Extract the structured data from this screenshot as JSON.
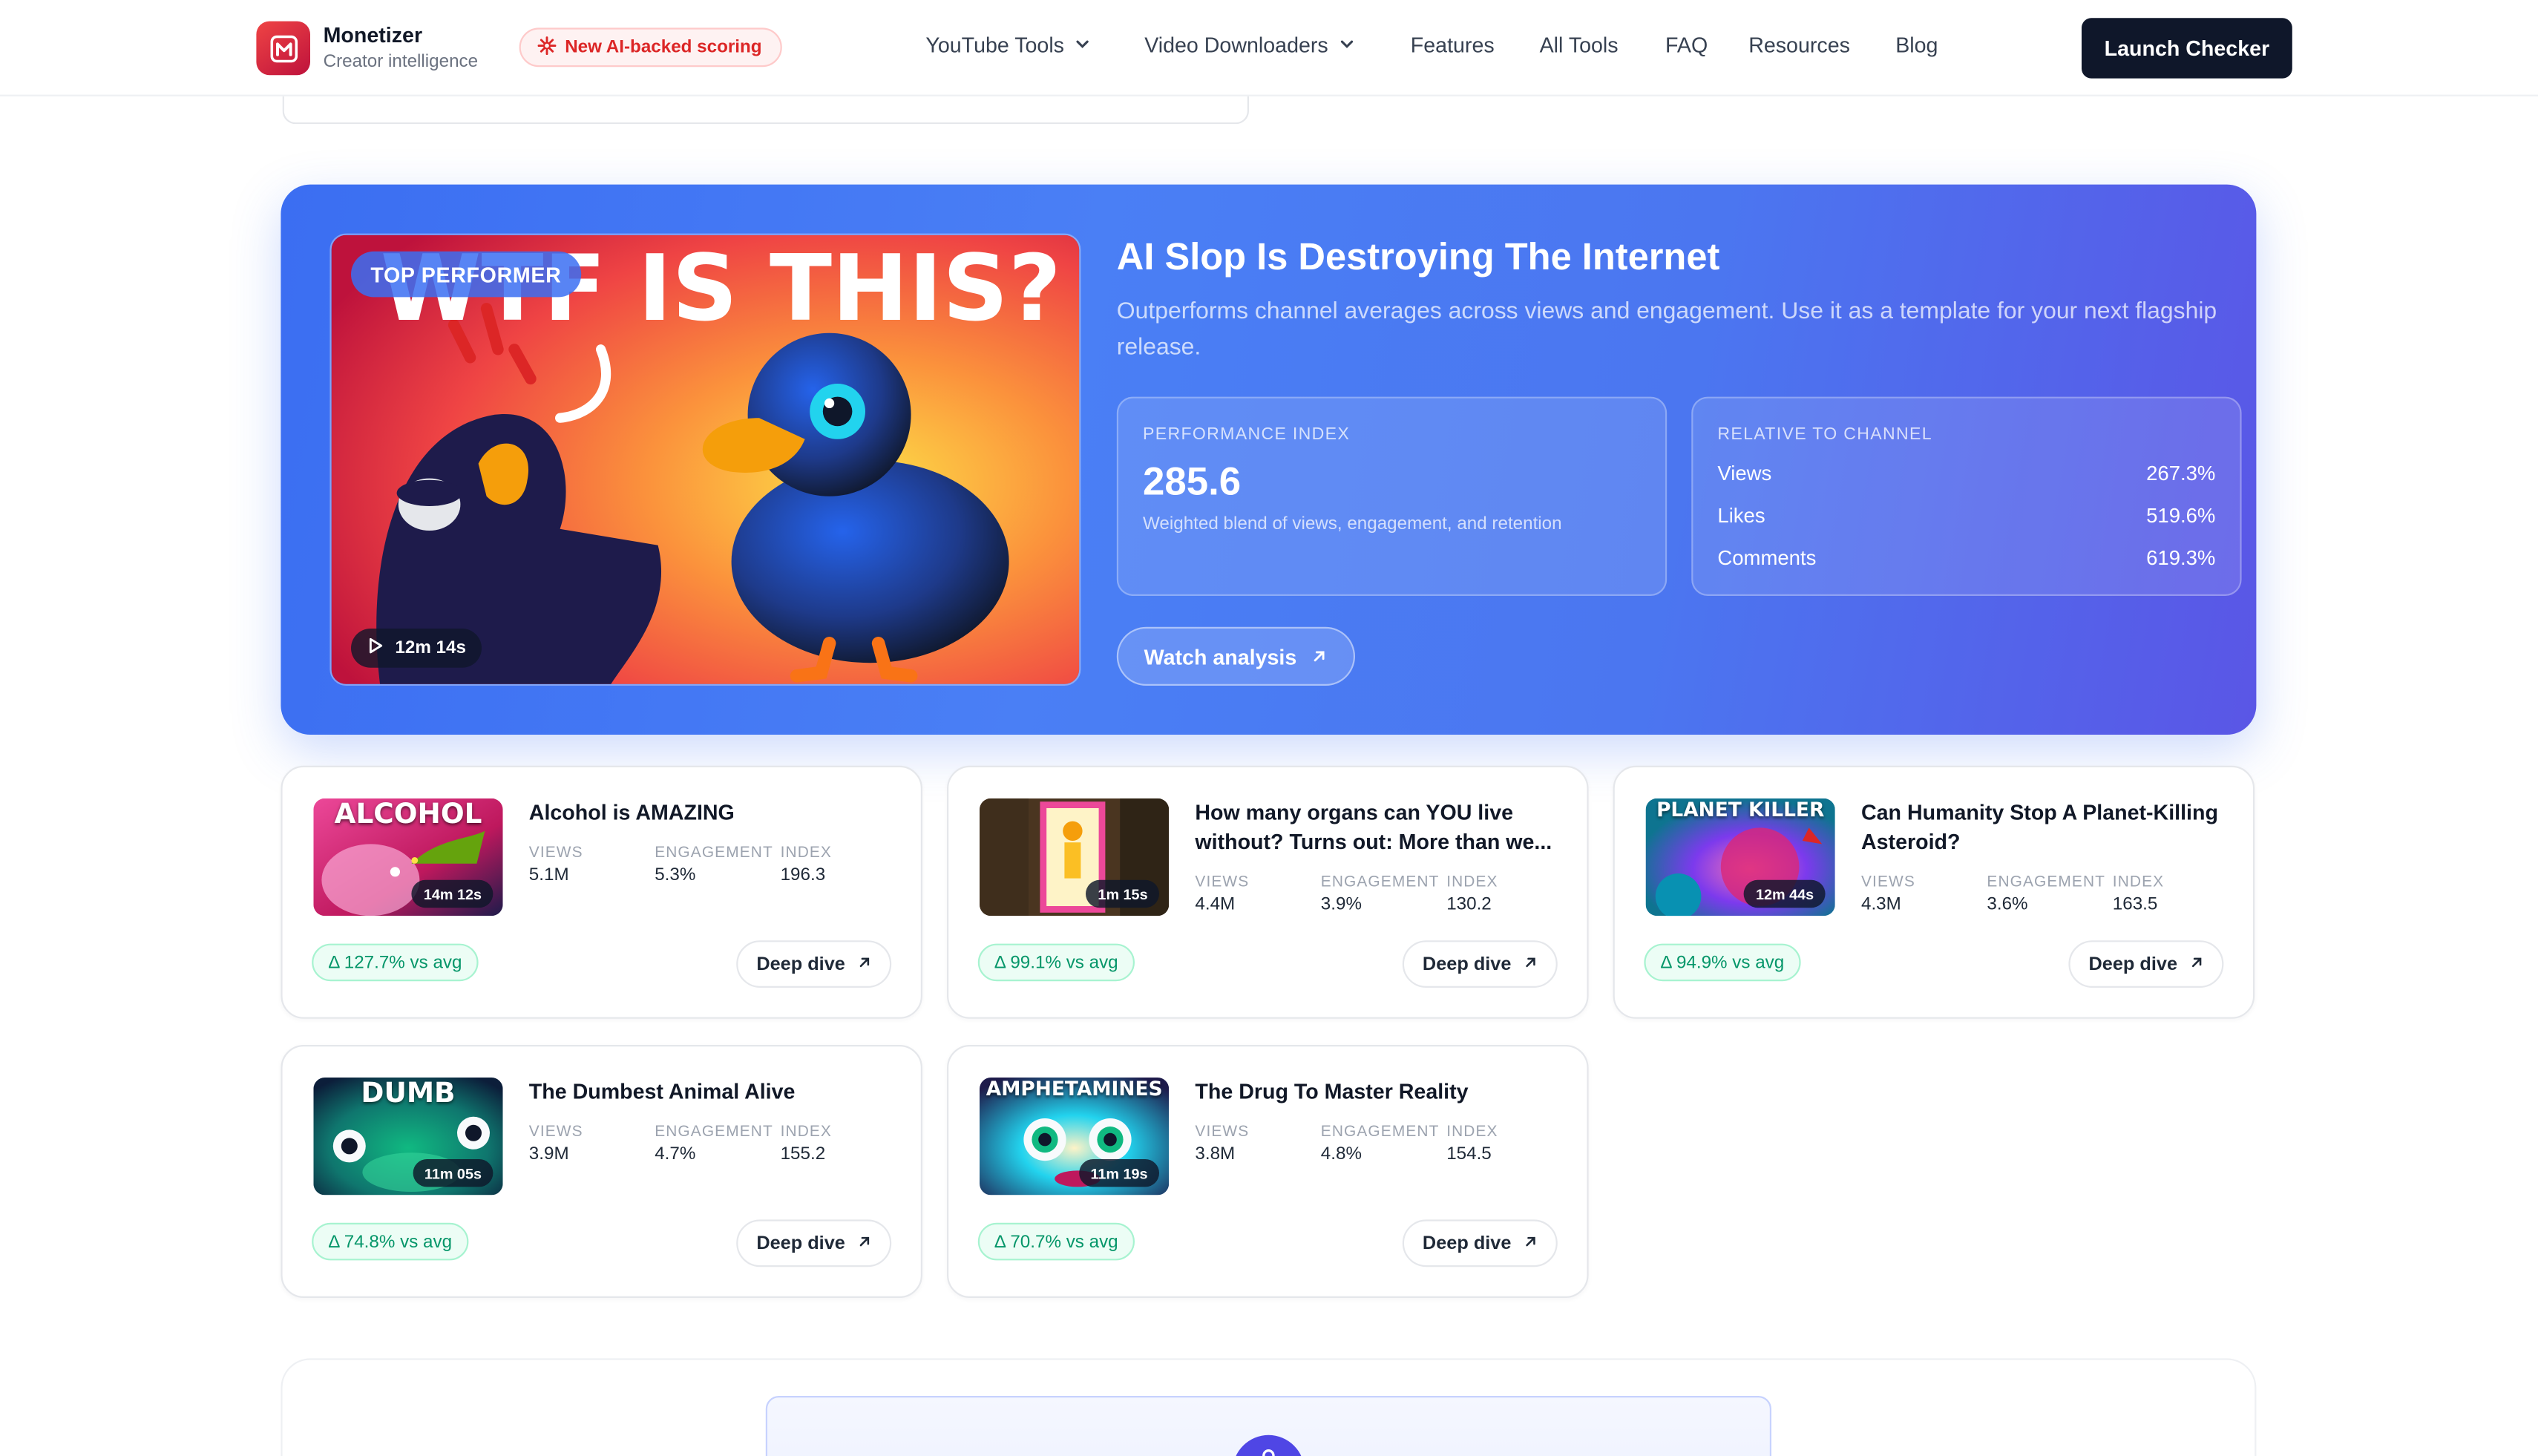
{
  "brand": {
    "name": "Monetizer",
    "tagline": "Creator intelligence",
    "badge": "New AI-backed scoring"
  },
  "nav": {
    "items": [
      {
        "label": "YouTube Tools",
        "dropdown": true
      },
      {
        "label": "Video Downloaders",
        "dropdown": true
      },
      {
        "label": "Features",
        "dropdown": false
      },
      {
        "label": "All Tools",
        "dropdown": false
      },
      {
        "label": "FAQ",
        "dropdown": false
      },
      {
        "label": "Resources",
        "dropdown": false
      },
      {
        "label": "Blog",
        "dropdown": false
      }
    ],
    "cta": "Launch Checker"
  },
  "hero": {
    "badge": "TOP PERFORMER",
    "thumb_text": "WTF IS THIS?",
    "duration": "12m 14s",
    "title": "AI Slop Is Destroying The Internet",
    "description": "Outperforms channel averages across views and engagement. Use it as a template for your next flagship release.",
    "performance": {
      "label": "PERFORMANCE INDEX",
      "value": "285.6",
      "note": "Weighted blend of views, engagement, and retention"
    },
    "relative": {
      "label": "RELATIVE TO CHANNEL",
      "rows": [
        {
          "label": "Views",
          "value": "267.3%"
        },
        {
          "label": "Likes",
          "value": "519.6%"
        },
        {
          "label": "Comments",
          "value": "619.3%"
        }
      ]
    },
    "watch_label": "Watch analysis"
  },
  "metric_labels": {
    "views": "VIEWS",
    "engagement": "ENGAGEMENT",
    "index": "INDEX"
  },
  "videos": [
    {
      "title": "Alcohol is AMAZING",
      "thumb_text": "ALCOHOL",
      "duration": "14m 12s",
      "views": "5.1M",
      "engagement": "5.3%",
      "index": "196.3",
      "delta": "Δ 127.7% vs avg",
      "action": "Deep dive"
    },
    {
      "title": "How many organs can YOU live without? Turns out: More than we...",
      "thumb_text": "",
      "duration": "1m 15s",
      "views": "4.4M",
      "engagement": "3.9%",
      "index": "130.2",
      "delta": "Δ 99.1% vs avg",
      "action": "Deep dive"
    },
    {
      "title": "Can Humanity Stop A Planet-Killing Asteroid?",
      "thumb_text": "PLANET KILLER",
      "duration": "12m 44s",
      "views": "4.3M",
      "engagement": "3.6%",
      "index": "163.5",
      "delta": "Δ 94.9% vs avg",
      "action": "Deep dive"
    },
    {
      "title": "The Dumbest Animal Alive",
      "thumb_text": "DUMB",
      "duration": "11m 05s",
      "views": "3.9M",
      "engagement": "4.7%",
      "index": "155.2",
      "delta": "Δ 74.8% vs avg",
      "action": "Deep dive"
    },
    {
      "title": "The Drug To Master Reality",
      "thumb_text": "AMPHETAMINES",
      "duration": "11m 19s",
      "views": "3.8M",
      "engagement": "4.8%",
      "index": "154.5",
      "delta": "Δ 70.7% vs avg",
      "action": "Deep dive"
    }
  ],
  "colors": {
    "brand": "#e11d48",
    "hero_start": "#3b6ef2",
    "hero_end": "#5a56e6",
    "delta_green": "#059669",
    "cta_dark": "#0f172a"
  }
}
